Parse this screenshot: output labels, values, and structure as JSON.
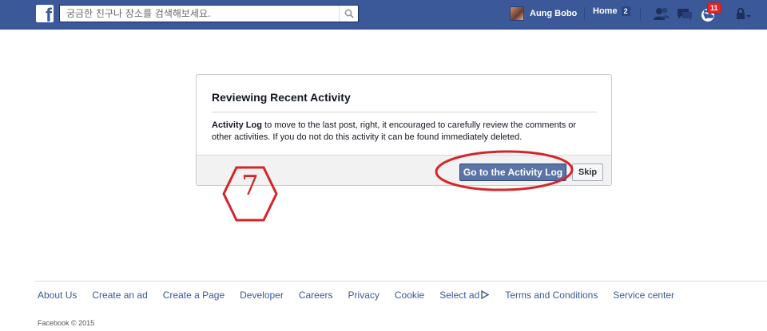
{
  "topbar": {
    "search_placeholder": "궁금한 친구나 장소를 검색해보세요.",
    "profile_name": "Aung Bobo",
    "home_label": "Home",
    "home_count": "2",
    "notifications_count": "11",
    "brand_color": "#3b5998"
  },
  "dialog": {
    "title": "Reviewing Recent Activity",
    "body_bold": "Activity Log",
    "body_text": " to move to the last post, right, it encouraged to carefully review the comments or other activities. If you do not do this activity it can be found immediately deleted.",
    "primary_button": "Go to the Activity Log",
    "skip_button": "Skip"
  },
  "annotation": {
    "step_number": "7",
    "color": "#d6252a"
  },
  "footer": {
    "links": [
      "About Us",
      "Create an ad",
      "Create a Page",
      "Developer",
      "Careers",
      "Privacy",
      "Cookie",
      "Select ad",
      "Terms and Conditions",
      "Service center"
    ],
    "copyright": "Facebook © 2015"
  }
}
